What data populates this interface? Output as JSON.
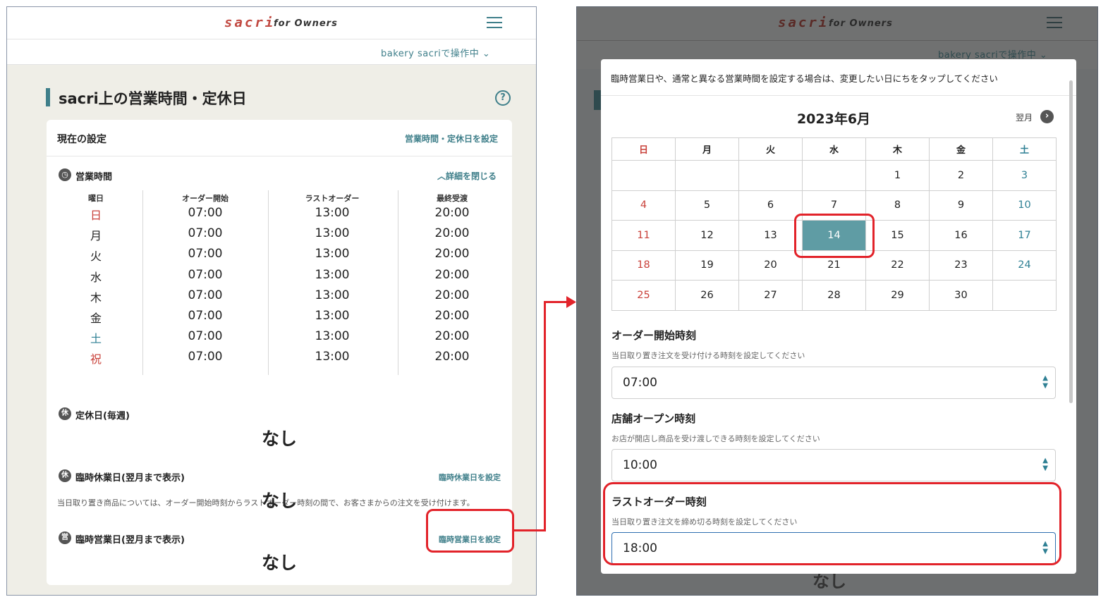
{
  "app": {
    "logo": "sacri",
    "logo_sub": "for Owners",
    "store_label": "bakery sacriで操作中 ⌄"
  },
  "left": {
    "page_title": "sacri上の営業時間・定休日",
    "card_title": "現在の設定",
    "set_hours_link": "営業時間・定休日を設定",
    "hours_section": "営業時間",
    "close_details": "詳細を閉じる",
    "columns": [
      "曜日",
      "オーダー開始",
      "ラストオーダー",
      "最終受渡"
    ],
    "rows": [
      {
        "day": "日",
        "start": "07:00",
        "last": "13:00",
        "final": "20:00"
      },
      {
        "day": "月",
        "start": "07:00",
        "last": "13:00",
        "final": "20:00"
      },
      {
        "day": "火",
        "start": "07:00",
        "last": "13:00",
        "final": "20:00"
      },
      {
        "day": "水",
        "start": "07:00",
        "last": "13:00",
        "final": "20:00"
      },
      {
        "day": "木",
        "start": "07:00",
        "last": "13:00",
        "final": "20:00"
      },
      {
        "day": "金",
        "start": "07:00",
        "last": "13:00",
        "final": "20:00"
      },
      {
        "day": "土",
        "start": "07:00",
        "last": "13:00",
        "final": "20:00"
      },
      {
        "day": "祝",
        "start": "07:00",
        "last": "13:00",
        "final": "20:00"
      }
    ],
    "note": "当日取り置き商品については、オーダー開始時刻からラストオーダー時刻の間で、お客さまからの注文を受け付けます。",
    "regular_holiday": "定休日(毎週)",
    "temp_closed": "臨時休業日(翌月まで表示)",
    "temp_closed_link": "臨時休業日を設定",
    "temp_open": "臨時営業日(翌月まで表示)",
    "temp_open_link": "臨時営業日を設定",
    "none": "なし",
    "icon_rest": "休",
    "icon_open": "営"
  },
  "right": {
    "modal_note": "臨時営業日や、通常と異なる営業時間を設定する場合は、変更したい日にちをタップしてください",
    "month": "2023年6月",
    "next_month": "翌月",
    "weekdays": [
      "日",
      "月",
      "火",
      "水",
      "木",
      "金",
      "土"
    ],
    "weeks": [
      [
        "",
        "",
        "",
        "",
        "1",
        "2",
        "3"
      ],
      [
        "4",
        "5",
        "6",
        "7",
        "8",
        "9",
        "10"
      ],
      [
        "11",
        "12",
        "13",
        "14",
        "15",
        "16",
        "17"
      ],
      [
        "18",
        "19",
        "20",
        "21",
        "22",
        "23",
        "24"
      ],
      [
        "25",
        "26",
        "27",
        "28",
        "29",
        "30",
        ""
      ]
    ],
    "selected_day": "14",
    "order_start_label": "オーダー開始時刻",
    "order_start_help": "当日取り置き注文を受け付ける時刻を設定してください",
    "order_start_value": "07:00",
    "open_label": "店舗オープン時刻",
    "open_help": "お店が開店し商品を受け渡しできる時刻を設定してください",
    "open_value": "10:00",
    "last_label": "ラストオーダー時刻",
    "last_help": "当日取り置き注文を締め切る時刻を設定してください",
    "last_value": "18:00",
    "behind_none": "なし"
  },
  "colors": {
    "accent": "#3f7f8a",
    "sunday": "#c9413a",
    "saturday": "#2f8094",
    "highlight": "#e2232a",
    "selected": "#5f9ca4"
  }
}
